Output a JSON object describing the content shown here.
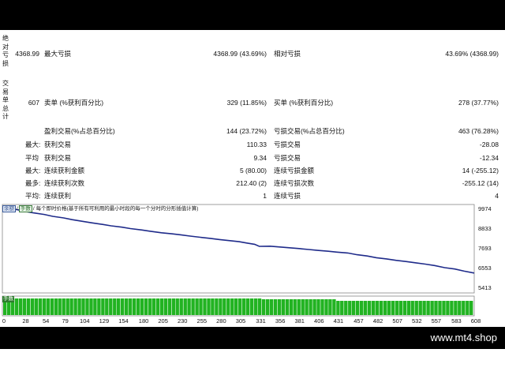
{
  "report": {
    "abs_dd": {
      "label": "绝对亏损",
      "value": "4368.99"
    },
    "max_dd": {
      "label": "最大亏损",
      "value": "4368.99 (43.69%)"
    },
    "rel_dd": {
      "label": "相对亏损",
      "value": "43.69% (4368.99)"
    },
    "trades": {
      "label": "交易单总计",
      "value": "607"
    },
    "short": {
      "label": "卖单 (%获利百分比)",
      "value": "329 (11.85%)"
    },
    "long": {
      "label": "买单 (%获利百分比)",
      "value": "278 (37.77%)"
    },
    "profit_trades": {
      "label": "盈利交易(%占总百分比)",
      "value": "144 (23.72%)"
    },
    "loss_trades": {
      "label": "亏损交易(%占总百分比)",
      "value": "463 (76.28%)"
    },
    "largest": {
      "prefix": "最大:",
      "profit_label": "获利交易",
      "profit_value": "110.33",
      "loss_label": "亏损交易",
      "loss_value": "-28.08"
    },
    "average": {
      "prefix": "平均",
      "profit_label": "获利交易",
      "profit_value": "9.34",
      "loss_label": "亏损交易",
      "loss_value": "-12.34"
    },
    "max_consec": {
      "prefix": "最大:",
      "profit_label": "连续获利金额",
      "profit_value": "5 (80.00)",
      "loss_label": "连续亏损金额",
      "loss_value": "14 (-255.12)"
    },
    "max_consec2": {
      "prefix": "最多:",
      "profit_label": "连续获利次数",
      "profit_value": "212.40 (2)",
      "loss_label": "连续亏损次数",
      "loss_value": "-255.12 (14)"
    },
    "avg_consec": {
      "prefix": "平均:",
      "profit_label": "连续获利",
      "profit_value": "1",
      "loss_label": "连续亏损",
      "loss_value": "4"
    }
  },
  "chart": {
    "tab_all": "余额",
    "tab_sep1": "/",
    "tab_lot": "手数",
    "tab_sep2": "/",
    "description": "每个即时价格(基于所有可利用的最小时段的每一个分时的分形插值计算)",
    "volume_label": "手数",
    "line_color": "#1f2b8a",
    "volume_color": "#22b322",
    "brand": "www.mt4.shop"
  },
  "chart_data": {
    "type": "line",
    "yticks": [
      "9974",
      "8833",
      "7693",
      "6553",
      "5413"
    ],
    "ytick_values": [
      9974,
      8833,
      7693,
      6553,
      5413
    ],
    "xticks": [
      "0",
      "28",
      "54",
      "79",
      "104",
      "129",
      "154",
      "180",
      "205",
      "230",
      "255",
      "280",
      "305",
      "331",
      "356",
      "381",
      "406",
      "431",
      "457",
      "482",
      "507",
      "532",
      "557",
      "583",
      "608"
    ],
    "ylim": [
      5200,
      10000
    ],
    "xlim": [
      0,
      608
    ],
    "series": [
      {
        "x": [
          0,
          10,
          20,
          28,
          40,
          54,
          65,
          79,
          90,
          104,
          115,
          129,
          140,
          154,
          165,
          180,
          190,
          205,
          218,
          230,
          242,
          255,
          268,
          280,
          292,
          305,
          315,
          325,
          331,
          345,
          356,
          370,
          381,
          395,
          406,
          420,
          431,
          445,
          457,
          470,
          482,
          495,
          507,
          520,
          532,
          545,
          557,
          570,
          583,
          595,
          608
        ],
        "y": [
          10000,
          9930,
          9880,
          9790,
          9700,
          9610,
          9500,
          9410,
          9310,
          9210,
          9130,
          9040,
          8960,
          8880,
          8800,
          8720,
          8650,
          8560,
          8500,
          8440,
          8370,
          8300,
          8240,
          8170,
          8110,
          8050,
          7970,
          7900,
          7780,
          7790,
          7750,
          7700,
          7660,
          7600,
          7550,
          7500,
          7450,
          7400,
          7300,
          7230,
          7130,
          7060,
          6980,
          6910,
          6840,
          6760,
          6680,
          6560,
          6480,
          6360,
          6250
        ]
      }
    ],
    "volume": {
      "values": [
        0.1,
        0.1,
        0.1,
        0.1,
        0.1
      ],
      "note": ""
    }
  }
}
